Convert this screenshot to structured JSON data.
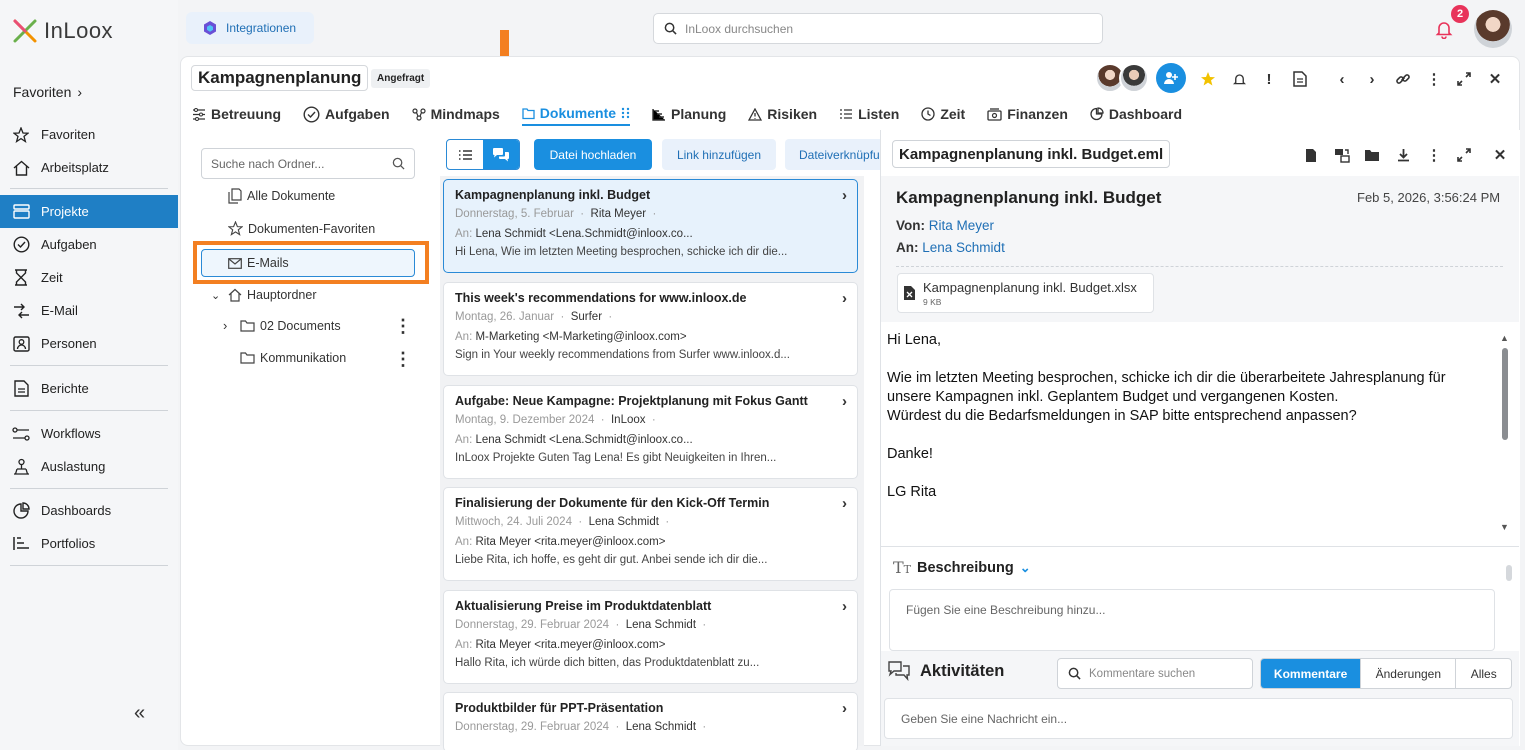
{
  "app": {
    "logo": "InLoox"
  },
  "sidebar": {
    "favorites_header": "Favoriten",
    "items": [
      {
        "label": "Favoriten",
        "icon": "star-icon"
      },
      {
        "label": "Arbeitsplatz",
        "icon": "home-icon"
      },
      {
        "label": "Projekte",
        "icon": "projects-icon",
        "active": true
      },
      {
        "label": "Aufgaben",
        "icon": "check-circle-icon"
      },
      {
        "label": "Zeit",
        "icon": "hourglass-icon"
      },
      {
        "label": "E-Mail",
        "icon": "email-sync-icon"
      },
      {
        "label": "Personen",
        "icon": "person-card-icon"
      },
      {
        "label": "Berichte",
        "icon": "report-icon"
      },
      {
        "label": "Workflows",
        "icon": "workflow-icon"
      },
      {
        "label": "Auslastung",
        "icon": "workload-icon"
      },
      {
        "label": "Dashboards",
        "icon": "pie-chart-icon"
      },
      {
        "label": "Portfolios",
        "icon": "portfolio-icon"
      }
    ],
    "collapse": "«"
  },
  "topbar": {
    "integrations_label": "Integrationen",
    "search_placeholder": "InLoox durchsuchen",
    "notification_count": "2"
  },
  "project": {
    "title": "Kampagnenplanung",
    "status": "Angefragt",
    "tabs": [
      {
        "label": "Betreuung",
        "icon": "sliders-icon"
      },
      {
        "label": "Aufgaben",
        "icon": "check-circle-icon"
      },
      {
        "label": "Mindmaps",
        "icon": "mindmap-icon"
      },
      {
        "label": "Dokumente",
        "icon": "documents-icon",
        "active": true
      },
      {
        "label": "Planung",
        "icon": "gantt-icon"
      },
      {
        "label": "Risiken",
        "icon": "warning-icon"
      },
      {
        "label": "Listen",
        "icon": "list-icon"
      },
      {
        "label": "Zeit",
        "icon": "clock-icon"
      },
      {
        "label": "Finanzen",
        "icon": "finance-icon"
      },
      {
        "label": "Dashboard",
        "icon": "dashboard-icon"
      }
    ]
  },
  "folders": {
    "search_placeholder": "Suche nach Ordner...",
    "all_docs": "Alle Dokumente",
    "favorites": "Dokumenten-Favoriten",
    "emails": "E-Mails",
    "main": "Hauptordner",
    "sub1": "02 Documents",
    "sub2": "Kommunikation"
  },
  "toolbar": {
    "upload": "Datei hochladen",
    "add_link": "Link hinzufügen",
    "file_link": "Dateiverknüpfu"
  },
  "mails": [
    {
      "subject": "Kampagnenplanung inkl. Budget",
      "date": "Donnerstag, 5. Februar",
      "from": "Rita Meyer",
      "to_label": "An:",
      "to": "Lena Schmidt <Lena.Schmidt@inloox.co...",
      "preview": "Hi Lena, Wie im letzten Meeting besprochen, schicke ich dir die..."
    },
    {
      "subject": "This week's recommendations for www.inloox.de",
      "date": "Montag, 26. Januar",
      "from": "Surfer",
      "to_label": "An:",
      "to": "M-Marketing <M-Marketing@inloox.com>",
      "preview": "Sign in Your weekly recommendations from Surfer www.inloox.d..."
    },
    {
      "subject": "Aufgabe: Neue Kampagne: Projektplanung mit Fokus Gantt",
      "date": "Montag, 9. Dezember 2024",
      "from": "InLoox",
      "to_label": "An:",
      "to": "Lena Schmidt <Lena.Schmidt@inloox.co...",
      "preview": "InLoox Projekte Guten Tag Lena! Es gibt Neuigkeiten in Ihren..."
    },
    {
      "subject": "Finalisierung der Dokumente für den Kick-Off Termin",
      "date": "Mittwoch, 24. Juli 2024",
      "from": "Lena Schmidt",
      "to_label": "An:",
      "to": "Rita Meyer <rita.meyer@inloox.com>",
      "preview": "Liebe Rita, ich hoffe, es geht dir gut. Anbei sende ich dir die..."
    },
    {
      "subject": "Aktualisierung Preise im Produktdatenblatt",
      "date": "Donnerstag, 29. Februar 2024",
      "from": "Lena Schmidt",
      "to_label": "An:",
      "to": "Rita Meyer <rita.meyer@inloox.com>",
      "preview": "Hallo Rita, ich würde dich bitten, das Produktdatenblatt zu..."
    },
    {
      "subject": "Produktbilder für PPT-Präsentation",
      "date": "Donnerstag, 29. Februar 2024",
      "from": "Lena Schmidt",
      "to_label": "",
      "to": "",
      "preview": ""
    }
  ],
  "viewer": {
    "filename": "Kampagnenplanung inkl. Budget.eml",
    "subject": "Kampagnenplanung inkl. Budget",
    "date": "Feb 5, 2026, 3:56:24 PM",
    "from_label": "Von:",
    "from": "Rita Meyer",
    "to_label": "An:",
    "to": "Lena Schmidt",
    "attachment_name": "Kampagnenplanung inkl. Budget.xlsx",
    "attachment_size": "9 KB",
    "body": "Hi Lena,\n\nWie im letzten Meeting besprochen, schicke ich dir die überarbeitete Jahresplanung für\nunsere Kampagnen inkl. Geplantem Budget und vergangenen Kosten.\nWürdest du die Bedarfsmeldungen in SAP bitte entsprechend anpassen?\n\nDanke!\n\nLG Rita",
    "description_title": "Beschreibung",
    "description_placeholder": "Fügen Sie eine Beschreibung hinzu...",
    "activities_title": "Aktivitäten",
    "comments_search": "Kommentare suchen",
    "seg_comments": "Kommentare",
    "seg_changes": "Änderungen",
    "seg_all": "Alles",
    "message_placeholder": "Geben Sie eine Nachricht ein..."
  },
  "colors": {
    "accent": "#1a8fe0",
    "highlight": "#f37f21",
    "sidebar_active": "#1f7fc5"
  }
}
